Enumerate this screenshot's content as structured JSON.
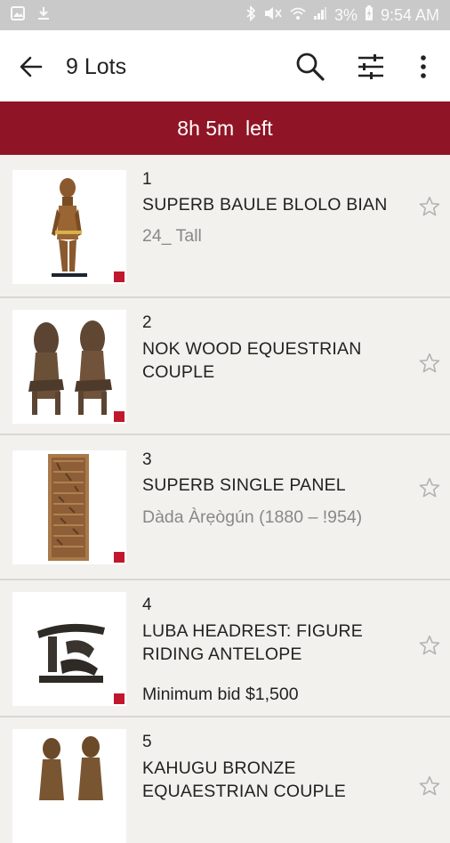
{
  "status_bar": {
    "battery": "3%",
    "time": "9:54 AM"
  },
  "app_bar": {
    "title": "9 Lots"
  },
  "banner": {
    "time_left": "8h 5m  left"
  },
  "lots": [
    {
      "number": "1",
      "title": "SUPERB BAULE BLOLO BIAN",
      "subtitle": "24_ Tall",
      "bid": ""
    },
    {
      "number": "2",
      "title": "NOK WOOD EQUESTRIAN COUPLE",
      "subtitle": "",
      "bid": ""
    },
    {
      "number": "3",
      "title": "SUPERB SINGLE PANEL",
      "subtitle": "Dàda Àrẹògún (1880 – !954)",
      "bid": ""
    },
    {
      "number": "4",
      "title": "LUBA HEADREST: FIGURE RIDING ANTELOPE",
      "subtitle": "",
      "bid": "Minimum bid $1,500"
    },
    {
      "number": "5",
      "title": "KAHUGU BRONZE EQUAESTRIAN COUPLE",
      "subtitle": "",
      "bid": ""
    }
  ],
  "colors": {
    "banner": "#8f1526",
    "status_bar": "#c9c9c9",
    "background": "#f2f1ed"
  }
}
